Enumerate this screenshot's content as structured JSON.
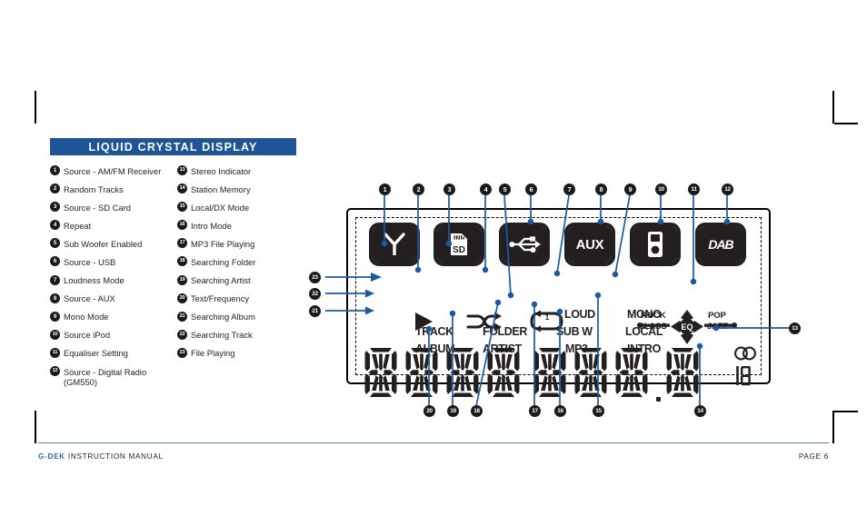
{
  "section": {
    "title": "LIQUID CRYSTAL DISPLAY"
  },
  "legend": {
    "column1": [
      {
        "n": "1",
        "label": "Source - AM/FM Receiver"
      },
      {
        "n": "2",
        "label": "Random Tracks"
      },
      {
        "n": "3",
        "label": "Source - SD Card"
      },
      {
        "n": "4",
        "label": "Repeat"
      },
      {
        "n": "5",
        "label": "Sub Woofer Enabled"
      },
      {
        "n": "6",
        "label": "Source - USB"
      },
      {
        "n": "7",
        "label": "Loudness Mode"
      },
      {
        "n": "8",
        "label": "Source - AUX"
      },
      {
        "n": "9",
        "label": "Mono Mode"
      },
      {
        "n": "10",
        "label": "Source iPod"
      },
      {
        "n": "11",
        "label": "Equaliser Setting"
      },
      {
        "n": "12",
        "label": "Source - Digital Radio",
        "label2": "(GM550)"
      }
    ],
    "column2": [
      {
        "n": "13",
        "label": "Stereo Indicator"
      },
      {
        "n": "14",
        "label": "Station Memory"
      },
      {
        "n": "15",
        "label": "Local/DX Mode"
      },
      {
        "n": "16",
        "label": "Intro Mode"
      },
      {
        "n": "17",
        "label": "MP3 File Playing"
      },
      {
        "n": "18",
        "label": "Searching Folder"
      },
      {
        "n": "19",
        "label": "Searching Artist"
      },
      {
        "n": "20",
        "label": "Text/Frequency"
      },
      {
        "n": "21",
        "label": "Searching Album"
      },
      {
        "n": "22",
        "label": "Searching Track"
      },
      {
        "n": "23",
        "label": "File Playing"
      }
    ]
  },
  "lcd": {
    "icons": [
      {
        "id": "antenna",
        "glyph": "antenna",
        "text": ""
      },
      {
        "id": "sd-card",
        "glyph": "sdcard",
        "text": "SD"
      },
      {
        "id": "usb",
        "glyph": "usb",
        "text": ""
      },
      {
        "id": "aux",
        "glyph": "text",
        "text": "AUX"
      },
      {
        "id": "ipod",
        "glyph": "ipod",
        "text": ""
      },
      {
        "id": "dab",
        "glyph": "text",
        "text": "DAB"
      }
    ],
    "indicators": {
      "loud": "LOUD",
      "subw": "SUB W",
      "mono": "MONO",
      "local": "LOCAL",
      "intro": "INTRO",
      "mp3": "MP3",
      "track": "TRACK",
      "album": "ALBUM",
      "folder": "FOLDER",
      "artist": "ARTIST"
    },
    "eq": {
      "center": "EQ",
      "rock": "ROCK",
      "pop": "POP",
      "class": "CLASS",
      "jazz": "JAZZ"
    },
    "segment_display": {
      "digit_count": 8,
      "decimal_point_after": 7,
      "memory_digit": true,
      "stereo_indicator": true
    },
    "callouts_top": [
      "1",
      "2",
      "3",
      "4",
      "5",
      "6",
      "7",
      "8",
      "9",
      "10",
      "11",
      "12"
    ],
    "callouts_bottom": [
      "20",
      "19",
      "18",
      "17",
      "16",
      "15"
    ],
    "callouts_left": [
      "23",
      "22",
      "21"
    ],
    "callouts_right": [
      "13"
    ],
    "callout_14": "14"
  },
  "footer": {
    "brand": "G-DEK",
    "text": "INSTRUCTION MANUAL",
    "page": "PAGE 6"
  },
  "colors": {
    "accent": "#1d5597",
    "lead": "#1b5aa0",
    "ink": "#231f20"
  }
}
